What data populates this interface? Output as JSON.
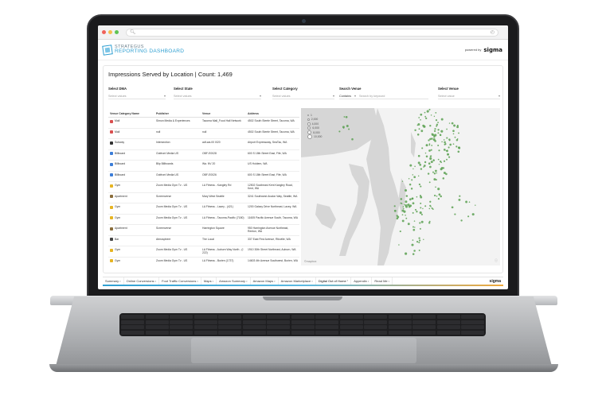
{
  "browser": {
    "dots": [
      "#f0625a",
      "#f5bf4f",
      "#5fc454"
    ]
  },
  "header": {
    "logo_line1": "STRATEGUS",
    "logo_line2": "REPORTING DASHBOARD",
    "powered_by": "powered by",
    "brand": "sigma"
  },
  "card": {
    "title": "Impressions Served by Location | Count: 1,469"
  },
  "filters": {
    "dma": {
      "label": "Select DMA",
      "placeholder": "Select values"
    },
    "state": {
      "label": "Select State",
      "placeholder": "Select values"
    },
    "category": {
      "label": "Select Category",
      "placeholder": "Select values"
    },
    "search": {
      "label": "Search Venue",
      "mode": "Contains",
      "placeholder": "Search by keyword"
    },
    "venue": {
      "label": "Select Venue",
      "placeholder": "Select value"
    }
  },
  "table": {
    "headers": [
      "Venue Category Name",
      "Publisher",
      "Venue",
      "Address"
    ],
    "rows": [
      {
        "category": "Mall",
        "color": "#d94f4f",
        "publisher": "Simon Media & Experiences",
        "venue": "Tacoma Mall_Food Hall Network",
        "address": "4502 South Steele Street, Tacoma, WA"
      },
      {
        "category": "Mall",
        "color": "#d94f4f",
        "publisher": "null",
        "venue": "null",
        "address": "4502 South Steele Street, Tacoma, WA"
      },
      {
        "category": "Subway",
        "color": "#333333",
        "publisher": "Intersection",
        "venue": "adf-wa-00 I020",
        "address": "Airport Expressway, SeaTac, WA"
      },
      {
        "category": "Billboard",
        "color": "#3b7dd8",
        "publisher": "Outfront Media US",
        "venue": "OBF-E0028",
        "address": "600 S 18th Street East, Fife, WA"
      },
      {
        "category": "Billboard",
        "color": "#3b7dd8",
        "publisher": "Blip Billboards",
        "venue": "Wa. NV 20",
        "address": "US Holdem, WA"
      },
      {
        "category": "Billboard",
        "color": "#3b7dd8",
        "publisher": "Outfront Media US",
        "venue": "OBF-E0026",
        "address": "600 S 18th Street East, Fife, WA"
      },
      {
        "category": "Gym",
        "color": "#e6b422",
        "publisher": "Zoom Media Gym Tv - US",
        "venue": "LA Fitness - Kangley Rd",
        "address": "12502 Southeast Kent Kangley Road, Kent, WA"
      },
      {
        "category": "Apartment",
        "color": "#8a6d3b",
        "publisher": "Screenverse",
        "venue": "Mary West Seattle",
        "address": "3241 Southwest Avalon Way, Seattle, WA"
      },
      {
        "category": "Gym",
        "color": "#e6b422",
        "publisher": "Zoom Media Gym Tv - US",
        "venue": "LA Fitness - Lacey - (421)",
        "address": "1200 Galaxy Drive Northeast, Lacey, WA"
      },
      {
        "category": "Gym",
        "color": "#e6b422",
        "publisher": "Zoom Media Gym Tv - US",
        "venue": "LA Fitness - Tacoma-Pacific (7180)",
        "address": "11605 Pacific Avenue South, Tacoma, WA"
      },
      {
        "category": "Apartment",
        "color": "#8a6d3b",
        "publisher": "Screenverse",
        "venue": "Harrington Square",
        "address": "950 Harrington Avenue Northeast, Renton, WA"
      },
      {
        "category": "Bar",
        "color": "#444444",
        "publisher": "Atmosphere",
        "venue": "The Local",
        "address": "337 East First Avenue, Ritzville, WA"
      },
      {
        "category": "Gym",
        "color": "#e6b422",
        "publisher": "Zoom Media Gym Tv - US",
        "venue": "LA Fitness - Auburn Way North - (I 222)",
        "address": "1910 30th Street Northeast, Auburn, WA"
      },
      {
        "category": "Gym",
        "color": "#e6b422",
        "publisher": "Zoom Media Gym Tv - US",
        "venue": "LA Fitness - Burien (1737)",
        "address": "14603 4th Avenue Southwest, Burien, WA"
      }
    ]
  },
  "map": {
    "legend": [
      "1",
      "2,000",
      "4,000",
      "6,000",
      "8,000",
      "10,000"
    ],
    "attribution": "©mapbox",
    "land_color": "#f3f3f3",
    "water_color": "#d6d6d6",
    "dot_color": "#5aa051"
  },
  "tabs": [
    {
      "label": "Summary",
      "active": false
    },
    {
      "label": "Online Conversions",
      "active": false
    },
    {
      "label": "Foot Traffic Conversions",
      "active": false
    },
    {
      "label": "Maps",
      "active": false
    },
    {
      "label": "Amazon Summary",
      "active": false
    },
    {
      "label": "Amazon Maps",
      "active": false
    },
    {
      "label": "Amazon Marketplace",
      "active": false
    },
    {
      "label": "Digital Out of Home",
      "active": true
    },
    {
      "label": "Appendix",
      "active": false
    },
    {
      "label": "Read Me",
      "active": false
    }
  ],
  "footer_brand": "sigma"
}
